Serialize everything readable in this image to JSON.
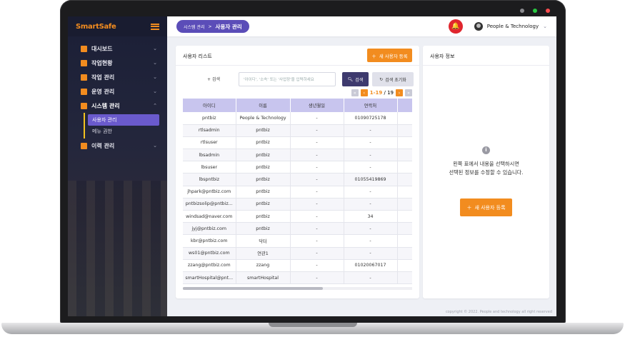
{
  "window": {
    "dots": [
      "#8a8a8e",
      "#28c840",
      "#ff4d4f"
    ]
  },
  "sidebar": {
    "brand": "SmartSafe",
    "items": [
      {
        "label": "대시보드",
        "chev": "⌄"
      },
      {
        "label": "작업현황",
        "chev": "⌄"
      },
      {
        "label": "작업 관리",
        "chev": "⌄"
      },
      {
        "label": "운영 관리",
        "chev": "⌄"
      },
      {
        "label": "시스템 관리",
        "chev": "⌃"
      },
      {
        "label": "이력 관리",
        "chev": "⌄"
      }
    ],
    "submenu": [
      "사용자 관리",
      "메뉴 권한"
    ]
  },
  "topbar": {
    "breadcrumb_parent": "시스템 관리",
    "breadcrumb_sep": ">",
    "breadcrumb_current": "사용자 관리",
    "user_name": "People & Technology",
    "user_chev": "⌄"
  },
  "list": {
    "title": "사용자 리스트",
    "new_button": "새 사용자 등록",
    "search_label": "검색",
    "search_placeholder": "'아이디', '소속' 또는 '사업장'을 입력하세요",
    "search_button": "검색",
    "reset_button": "검색 초기화",
    "pager": {
      "range": "1-19",
      "sep": " / ",
      "total": "19"
    },
    "columns": [
      "아이디",
      "이름",
      "생년월일",
      "연락처"
    ],
    "rows": [
      [
        "pntbiz",
        "People & Technology",
        "-",
        "01090725178"
      ],
      [
        "rtlsadmin",
        "pntbiz",
        "-",
        "-"
      ],
      [
        "rtlsuser",
        "pntbiz",
        "-",
        "-"
      ],
      [
        "lbsadmin",
        "pntbiz",
        "-",
        "-"
      ],
      [
        "lbsuser",
        "pntbiz",
        "-",
        "-"
      ],
      [
        "lbspntbiz",
        "pntbiz",
        "-",
        "01055419869"
      ],
      [
        "jhpark@pntbiz.com",
        "pntbiz",
        "-",
        "-"
      ],
      [
        "pntbizsolip@pntbiz...",
        "pntbiz",
        "-",
        "-"
      ],
      [
        "windsad@naver.com",
        "pntbiz",
        "-",
        "34"
      ],
      [
        "jyj@pntbiz.com",
        "pntbiz",
        "-",
        "-"
      ],
      [
        "kbr@pntbiz.com",
        "닥터",
        "-",
        "-"
      ],
      [
        "ws01@pntbiz.com",
        "연관1",
        "-",
        "-"
      ],
      [
        "zzang@pntbiz.com",
        "zzang",
        "-",
        "01020067017"
      ],
      [
        "smartHospital@pnt...",
        "smartHospital",
        "-",
        "-"
      ]
    ]
  },
  "info": {
    "title": "사용자 정보",
    "message_line1": "왼쪽 표에서 내용을 선택하시면",
    "message_line2": "선택된 정보를 수정할 수 있습니다.",
    "new_button": "새 사용자 등록"
  },
  "footer": "copyright © 2022. People and technology all right reserved"
}
